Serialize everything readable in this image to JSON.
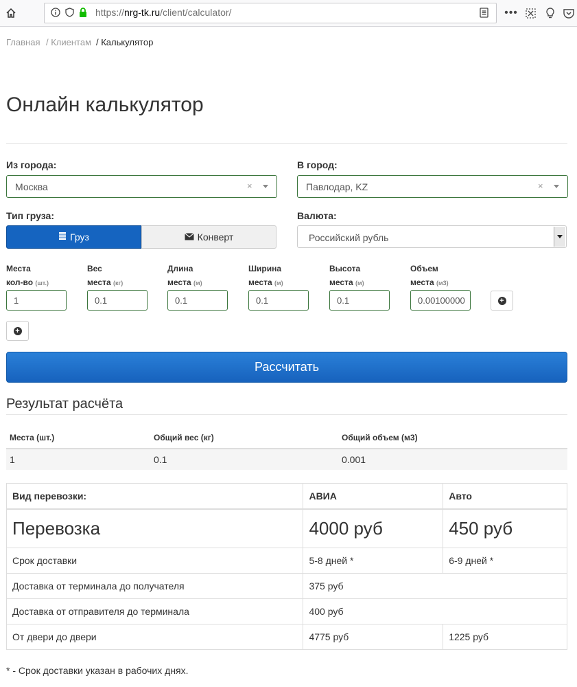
{
  "browser": {
    "url_scheme": "https://",
    "url_host": "nrg-tk.ru",
    "url_path": "/client/calculator/"
  },
  "breadcrumb": {
    "home": "Главная",
    "clients": "/ Клиентам",
    "current": "/ Калькулятор"
  },
  "page": {
    "title": "Онлайн калькулятор"
  },
  "form": {
    "from_label": "Из города:",
    "from_value": "Москва",
    "to_label": "В город:",
    "to_value": "Павлодар, KZ",
    "cargo_type_label": "Тип груза:",
    "cargo_button": "Груз",
    "envelope_button": "Конверт",
    "currency_label": "Валюта:",
    "currency_value": "Российский рубль",
    "clear_symbol": "×",
    "fields": [
      {
        "line1": "Места",
        "line2": "кол-во",
        "unit": "(шт.)",
        "value": "1"
      },
      {
        "line1": "Вес",
        "line2": "места",
        "unit": "(кг)",
        "value": "0.1"
      },
      {
        "line1": "Длина",
        "line2": "места",
        "unit": "(м)",
        "value": "0.1"
      },
      {
        "line1": "Ширина",
        "line2": "места",
        "unit": "(м)",
        "value": "0.1"
      },
      {
        "line1": "Высота",
        "line2": "места",
        "unit": "(м)",
        "value": "0.1"
      },
      {
        "line1": "Объем",
        "line2": "места",
        "unit": "(м3)",
        "value": "0.00100000"
      }
    ],
    "calculate_button": "Рассчитать"
  },
  "results": {
    "title": "Результат расчёта",
    "summary_headers": [
      "Места (шт.)",
      "Общий вес (кг)",
      "Общий объем (м3)"
    ],
    "summary_values": [
      "1",
      "0.1",
      "0.001"
    ],
    "table": {
      "headers": [
        "Вид перевозки:",
        "АВИА",
        "Авто"
      ],
      "transport": [
        "Перевозка",
        "4000 руб",
        "450 руб"
      ],
      "delivery_time": [
        "Срок доставки",
        "5-8 дней *",
        "6-9 дней *"
      ],
      "terminal_to_receiver": [
        "Доставка от терминала до получателя",
        "375 руб"
      ],
      "sender_to_terminal": [
        "Доставка от отправителя до терминала",
        "400 руб"
      ],
      "door_to_door": [
        "От двери до двери",
        "4775 руб",
        "1225 руб"
      ]
    },
    "footnote": "* - Срок доставки указан в рабочих днях."
  },
  "colors": {
    "primary_button": "#1564c0",
    "input_border_success": "#3c763d"
  }
}
